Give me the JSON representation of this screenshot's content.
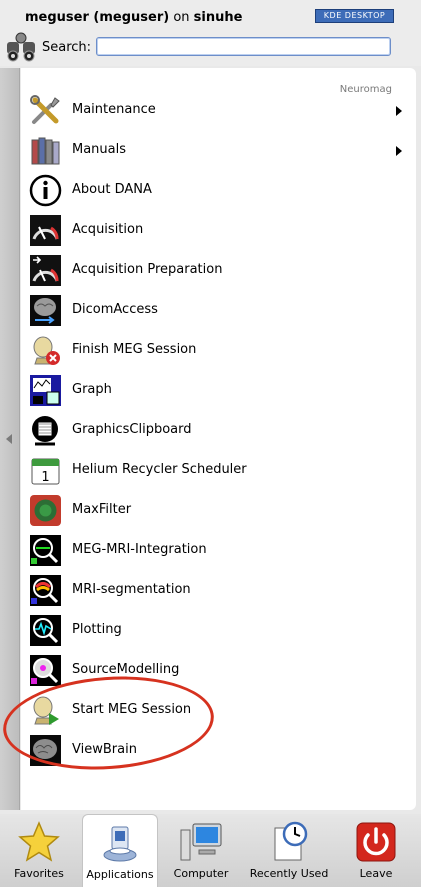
{
  "header": {
    "user_name": "meguser (meguser)",
    "on_text": "on",
    "host": "sinuhe",
    "kde_badge": "KDE DESKTOP",
    "search_label": "Search:",
    "search_value": ""
  },
  "menu": {
    "group_label": "Neuromag",
    "items": [
      {
        "label": "Maintenance",
        "icon": "tools-icon",
        "submenu": true
      },
      {
        "label": "Manuals",
        "icon": "books-icon",
        "submenu": true
      },
      {
        "label": "About DANA",
        "icon": "info-icon",
        "submenu": false
      },
      {
        "label": "Acquisition",
        "icon": "gauge-icon",
        "submenu": false
      },
      {
        "label": "Acquisition Preparation",
        "icon": "gauge-prep-icon",
        "submenu": false
      },
      {
        "label": "DicomAccess",
        "icon": "brain-dicom-icon",
        "submenu": false
      },
      {
        "label": "Finish MEG Session",
        "icon": "finish-session-icon",
        "submenu": false
      },
      {
        "label": "Graph",
        "icon": "graph-icon",
        "submenu": false
      },
      {
        "label": "GraphicsClipboard",
        "icon": "clipboard-head-icon",
        "submenu": false
      },
      {
        "label": "Helium Recycler Scheduler",
        "icon": "calendar-icon",
        "submenu": false
      },
      {
        "label": "MaxFilter",
        "icon": "maxfilter-icon",
        "submenu": false
      },
      {
        "label": "MEG-MRI-Integration",
        "icon": "meg-mri-icon",
        "submenu": false
      },
      {
        "label": "MRI-segmentation",
        "icon": "mri-segmentation-icon",
        "submenu": false
      },
      {
        "label": "Plotting",
        "icon": "plotting-icon",
        "submenu": false
      },
      {
        "label": "SourceModelling",
        "icon": "source-modelling-icon",
        "submenu": false
      },
      {
        "label": "Start MEG Session",
        "icon": "start-session-icon",
        "submenu": false
      },
      {
        "label": "ViewBrain",
        "icon": "brain-icon",
        "submenu": false
      }
    ]
  },
  "tabs": [
    {
      "label": "Favorites",
      "icon": "star-icon",
      "active": false
    },
    {
      "label": "Applications",
      "icon": "applications-icon",
      "active": true
    },
    {
      "label": "Computer",
      "icon": "computer-icon",
      "active": false
    },
    {
      "label": "Recently Used",
      "icon": "clock-document-icon",
      "active": false
    },
    {
      "label": "Leave",
      "icon": "power-icon",
      "active": false
    }
  ],
  "colors": {
    "annotation": "#d6321f",
    "kde_blue": "#3d6cb8",
    "search_border": "#6d8ec9"
  }
}
